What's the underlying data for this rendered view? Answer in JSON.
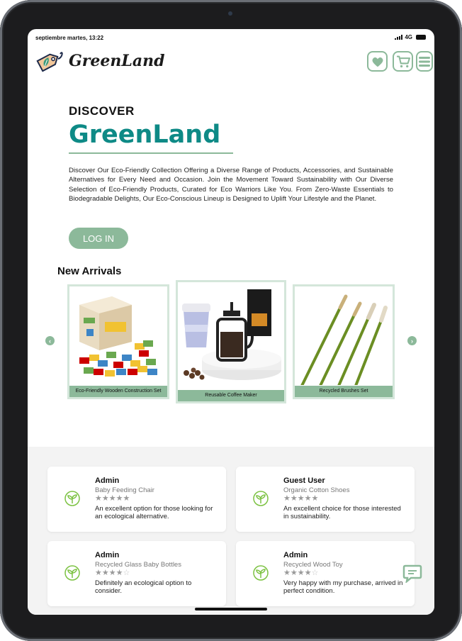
{
  "status_bar": {
    "time": "septiembre martes, 13:22",
    "network": "4G"
  },
  "brand": {
    "name": "GreenLand",
    "accent_color": "#8cb99a",
    "title_color": "#0e8a86"
  },
  "nav": {
    "icons": [
      "heart-icon",
      "cart-icon",
      "menu-icon"
    ]
  },
  "hero": {
    "kicker": "DISCOVER",
    "title": "GreenLand",
    "description": "Discover Our Eco-Friendly Collection Offering a Diverse Range of Products, Accessories, and Sustainable Alternatives for Every Need and Occasion. Join the Movement Toward Sustainability with Our Diverse Selection of Eco-Friendly Products, Curated for Eco Warriors Like You. From Zero-Waste Essentials to Biodegradable Delights, Our Eco-Conscious Lineup is Designed to Uplift Your Lifestyle and the Planet.",
    "login_label": "LOG IN"
  },
  "arrivals": {
    "title": "New Arrivals",
    "items": [
      {
        "name": "Eco-Friendly Wooden Construction Set"
      },
      {
        "name": "Reusable Coffee Maker"
      },
      {
        "name": "Recycled Brushes Set"
      }
    ]
  },
  "reviews": [
    {
      "user": "Admin",
      "product": "Baby Feeding Chair",
      "rating": 5,
      "text": "An excellent option for those looking for an ecological alternative."
    },
    {
      "user": "Guest User",
      "product": "Organic Cotton Shoes",
      "rating": 5,
      "text": "An excellent choice for those interested in sustainability."
    },
    {
      "user": "Admin",
      "product": "Recycled Glass Baby Bottles",
      "rating": 4,
      "text": "Definitely an ecological option to consider."
    },
    {
      "user": "Admin",
      "product": "Recycled Wood Toy",
      "rating": 4,
      "text": "Very happy with my purchase, arrived in perfect condition."
    }
  ]
}
